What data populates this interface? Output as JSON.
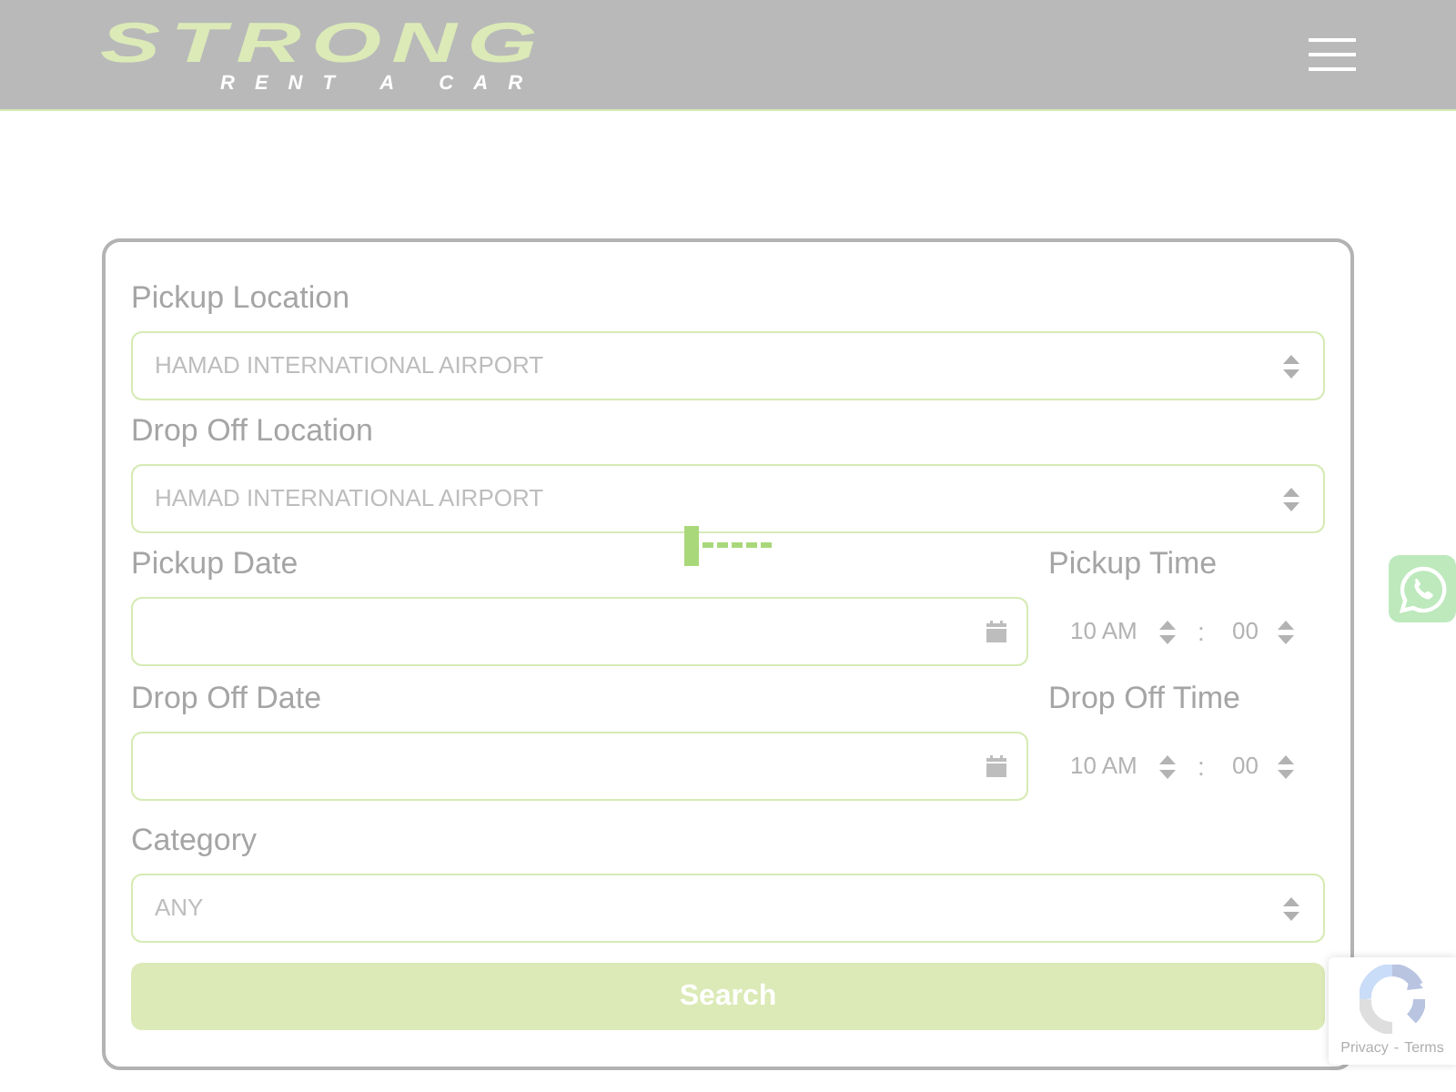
{
  "header": {
    "logo": {
      "title": "STRONG",
      "subtitle": "RENT A CAR"
    }
  },
  "search_form": {
    "locations": [
      {
        "label": "Pickup Location",
        "value": "HAMAD INTERNATIONAL AIRPORT"
      },
      {
        "label": "Drop Off Location",
        "value": "HAMAD INTERNATIONAL AIRPORT"
      }
    ],
    "schedule": [
      {
        "date_label": "Pickup Date",
        "time_label": "Pickup Time",
        "hour": "10 AM",
        "separator": ":",
        "minute": "00"
      },
      {
        "date_label": "Drop Off Date",
        "time_label": "Drop Off Time",
        "hour": "10 AM",
        "separator": ":",
        "minute": "00"
      }
    ],
    "category": {
      "label": "Category",
      "value": "ANY"
    },
    "submit_button": "Search"
  },
  "recaptcha_badge": {
    "links": [
      "Privacy",
      "Terms"
    ],
    "separator": "-"
  }
}
